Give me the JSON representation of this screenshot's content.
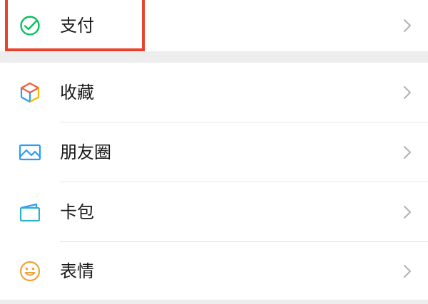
{
  "menu": {
    "pay": {
      "label": "支付",
      "icon": "pay-check-icon",
      "color": "#07c160"
    },
    "items": [
      {
        "label": "收藏",
        "icon": "favorites-cube-icon"
      },
      {
        "label": "朋友圈",
        "icon": "moments-picture-icon"
      },
      {
        "label": "卡包",
        "icon": "card-wallet-icon"
      },
      {
        "label": "表情",
        "icon": "sticker-smile-icon"
      }
    ]
  },
  "annotation": {
    "highlight_color": "#e8432e"
  }
}
